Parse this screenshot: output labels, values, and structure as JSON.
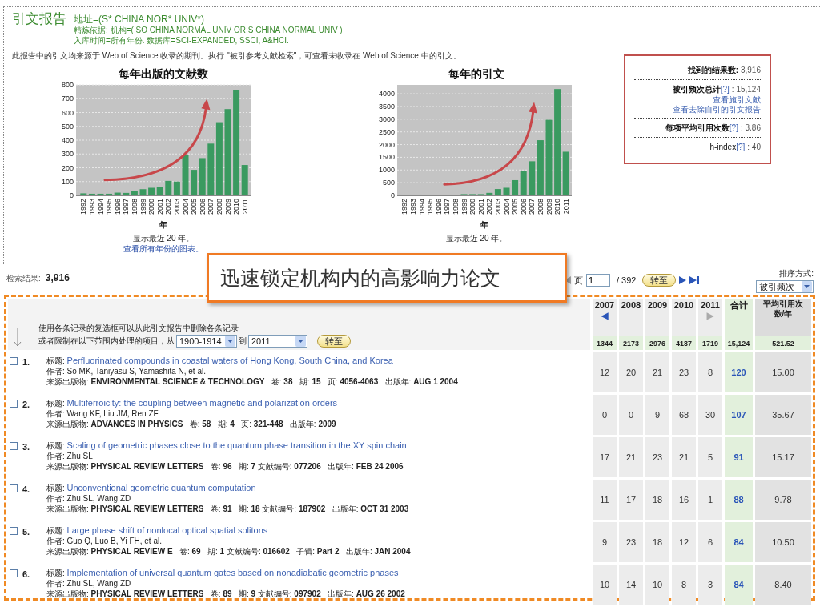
{
  "header": {
    "title": "引文报告",
    "query": "地址=(S* CHINA NOR* UNIV*)",
    "refined": "精炼依据: 机构=( SO CHINA NORMAL UNIV OR S CHINA NORMAL UNIV )",
    "timespan": "入库时间=所有年份. 数据库=SCI-EXPANDED, SSCI, A&HCI."
  },
  "note": "此报告中的引文均来源于 Web of Science 收录的期刊。执行 \"被引参考文献检索\"，可查看未收录在 Web of Science 中的引文。",
  "charts": [
    {
      "caption": "显示最近 20 年。",
      "link": "查看所有年份的图表。",
      "chart_data": {
        "type": "bar",
        "title": "每年出版的文献数",
        "xlabel": "年",
        "categories": [
          "1992",
          "1993",
          "1994",
          "1995",
          "1996",
          "1997",
          "1998",
          "1999",
          "2000",
          "2001",
          "2002",
          "2003",
          "2004",
          "2005",
          "2006",
          "2007",
          "2008",
          "2009",
          "2010",
          "2011"
        ],
        "values": [
          15,
          12,
          12,
          12,
          20,
          18,
          30,
          45,
          55,
          60,
          105,
          100,
          290,
          185,
          270,
          375,
          530,
          625,
          760,
          220
        ],
        "ylim": [
          0,
          800
        ],
        "yticks": [
          0,
          100,
          200,
          300,
          400,
          500,
          600,
          700,
          800
        ],
        "grid": true
      },
      "trend_arrow": true
    },
    {
      "caption": "显示最近 20 年。",
      "chart_data": {
        "type": "bar",
        "title": "每年的引文",
        "xlabel": "年",
        "categories": [
          "1992",
          "1993",
          "1994",
          "1995",
          "1996",
          "1997",
          "1998",
          "1999",
          "2000",
          "2001",
          "2002",
          "2003",
          "2004",
          "2005",
          "2006",
          "2007",
          "2008",
          "2009",
          "2010",
          "2011"
        ],
        "values": [
          0,
          0,
          0,
          0,
          0,
          0,
          0,
          50,
          50,
          50,
          100,
          250,
          300,
          600,
          950,
          1344,
          2173,
          2976,
          4187,
          1719
        ],
        "ylim": [
          0,
          4350
        ],
        "yticks": [
          0,
          500,
          1000,
          1500,
          2000,
          2500,
          3000,
          3500,
          4000
        ],
        "grid": true
      },
      "trend_arrow": true
    }
  ],
  "summary": [
    {
      "label": "找到的结果数:",
      "value": "3,916",
      "bold": true
    },
    {
      "label": "被引频次总计",
      "help": "[?]",
      "value": ": 15,124",
      "links": [
        "查看施引文献",
        "查看去除自引的引文报告"
      ],
      "bold": true
    },
    {
      "label": "每项平均引用次数",
      "help": "[?]",
      "value": ": 3.86",
      "bold": true
    },
    {
      "label": "h-index",
      "help": "[?]",
      "value": ": 40",
      "bold": false
    }
  ],
  "results": {
    "label": "检索结果:",
    "count": "3,916"
  },
  "pagination": {
    "page_label": "页",
    "page": "1",
    "total": "/ 392",
    "go": "转至"
  },
  "sort": {
    "label": "排序方式:",
    "value": "被引频次"
  },
  "callout": {
    "text": "迅速锁定机构内的高影响力论文"
  },
  "table": {
    "instruction": "使用各条记录的复选框可以从此引文报告中删除各条记录",
    "range_label": "或者限制在以下范围内处理的项目，从",
    "from": "1900-1914",
    "to_label": "到",
    "to": "2011",
    "go": "转至",
    "columns": [
      {
        "kind": "year",
        "label": "2007",
        "arrow": "◀",
        "disabled": false
      },
      {
        "kind": "year",
        "label": "2008"
      },
      {
        "kind": "year",
        "label": "2009"
      },
      {
        "kind": "year",
        "label": "2010"
      },
      {
        "kind": "year",
        "label": "2011",
        "arrow": "▶",
        "disabled": true
      },
      {
        "kind": "total",
        "label": "合计"
      },
      {
        "kind": "average",
        "label": "平均引用次数/年"
      }
    ],
    "totals": [
      "1344",
      "2173",
      "2976",
      "4187",
      "1719",
      "15,124",
      "521.52"
    ],
    "rows": [
      {
        "number": "1.",
        "checked": false,
        "title_label": "标题:",
        "title": "Perfluorinated compounds in coastal waters of Hong Kong, South China, and Korea",
        "authors": "作者: So MK, Taniyasu S, Yamashita N, et al.",
        "source": "来源出版物: **ENVIRONMENTAL SCIENCE & TECHNOLOGY**   卷: **38**   期: **15**   页: **4056-4063**   出版年: **AUG 1 2004**",
        "counts": [
          "12",
          "20",
          "21",
          "23",
          "8"
        ],
        "total": "120",
        "average": "15.00"
      },
      {
        "number": "2.",
        "checked": false,
        "title_label": "标题:",
        "title": "Multiferroicity: the coupling between magnetic and polarization orders",
        "authors": "作者: Wang KF, Liu JM, Ren ZF",
        "source": "来源出版物: **ADVANCES IN PHYSICS**   卷: **58**   期: **4**   页: **321-448**   出版年: **2009**",
        "counts": [
          "0",
          "0",
          "9",
          "68",
          "30"
        ],
        "total": "107",
        "average": "35.67"
      },
      {
        "number": "3.",
        "checked": false,
        "title_label": "标题:",
        "title": "Scaling of geometric phases close to the quantum phase transition in the XY spin chain",
        "authors": "作者: Zhu SL",
        "source": "来源出版物: **PHYSICAL REVIEW LETTERS**   卷: **96**   期: **7** 文献编号: **077206**   出版年: **FEB 24 2006**",
        "counts": [
          "17",
          "21",
          "23",
          "21",
          "5"
        ],
        "total": "91",
        "average": "15.17"
      },
      {
        "number": "4.",
        "checked": false,
        "title_label": "标题:",
        "title": "Unconventional geometric quantum computation",
        "authors": "作者: Zhu SL, Wang ZD",
        "source": "来源出版物: **PHYSICAL REVIEW LETTERS**   卷: **91**   期: **18** 文献编号: **187902**   出版年: **OCT 31 2003**",
        "counts": [
          "11",
          "17",
          "18",
          "16",
          "1"
        ],
        "total": "88",
        "average": "9.78"
      },
      {
        "number": "5.",
        "checked": false,
        "title_label": "标题:",
        "title": "Large phase shift of nonlocal optical spatial solitons",
        "authors": "作者: Guo Q, Luo B, Yi FH, et al.",
        "source": "来源出版物: **PHYSICAL REVIEW E**   卷: **69**   期: **1** 文献编号: **016602**   子辑: **Part 2**   出版年: **JAN 2004**",
        "counts": [
          "9",
          "23",
          "18",
          "12",
          "6"
        ],
        "total": "84",
        "average": "10.50"
      },
      {
        "number": "6.",
        "checked": false,
        "title_label": "标题:",
        "title": "Implementation of universal quantum gates based on nonadiabatic geometric phases",
        "authors": "作者: Zhu SL, Wang ZD",
        "source": "来源出版物: **PHYSICAL REVIEW LETTERS**   卷: **89**   期: **9** 文献编号: **097902**   出版年: **AUG 26 2002**",
        "counts": [
          "10",
          "14",
          "10",
          "8",
          "3"
        ],
        "total": "84",
        "average": "8.40"
      }
    ]
  }
}
